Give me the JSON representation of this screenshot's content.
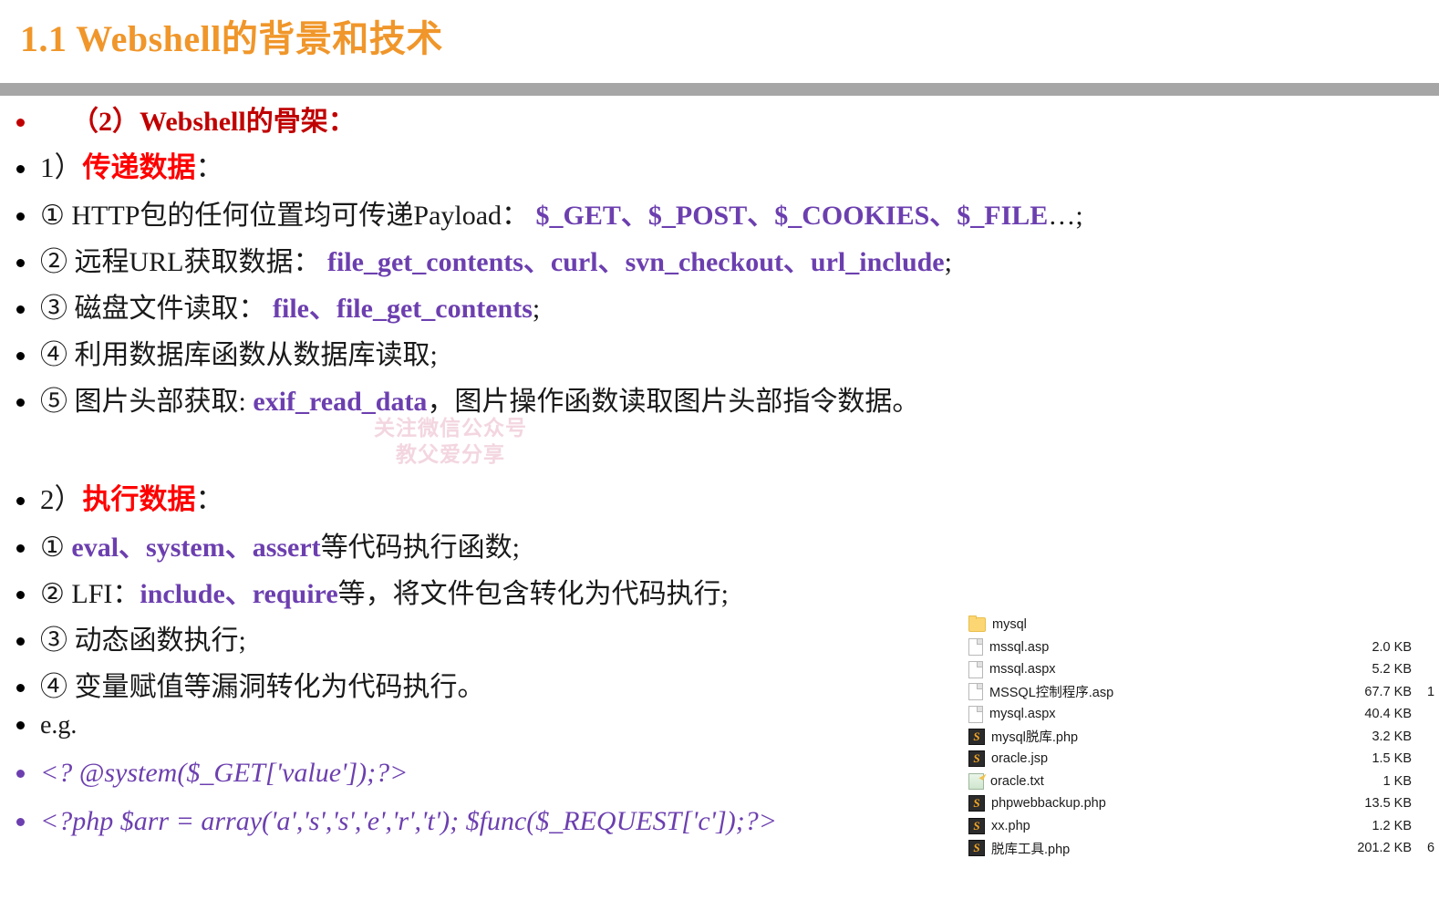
{
  "slide": {
    "title": "1.1 Webshell的背景和技术",
    "title_color": "#F0962A",
    "rule_color": "#A6A6A6",
    "background": "#FFFFFF"
  },
  "watermark": {
    "line1": "关注微信公众号",
    "line2": "教父爱分享",
    "color": "#F3D6E0"
  },
  "colors": {
    "code_purple": "#6C3FAF",
    "heading_red": "#C00000",
    "bright_red": "#FF0000",
    "body_black": "#1A1A1A"
  },
  "bullets": [
    {
      "id": "heading-skeleton",
      "dot_color": "#C00000",
      "runs": [
        {
          "text": "（2）Webshell的骨架：",
          "style": "red-serif-bold"
        }
      ]
    },
    {
      "id": "section-1-pass-data",
      "dot_color": "#000000",
      "runs": [
        {
          "text": "1）",
          "style": "serif-black"
        },
        {
          "text": "传递数据",
          "style": "bright-red-bold"
        },
        {
          "text": "：",
          "style": "serif-black"
        }
      ]
    },
    {
      "id": "item-1-1",
      "dot_color": "#000000",
      "runs": [
        {
          "text": "① HTTP包的任何位置均可传递Payload：",
          "style": "serif-black"
        },
        {
          "text": "  $_GET、$_POST、$_COOKIES、$_FILE",
          "style": "code-purple"
        },
        {
          "text": "…;",
          "style": "serif-black"
        }
      ]
    },
    {
      "id": "item-1-2",
      "dot_color": "#000000",
      "runs": [
        {
          "text": "② 远程URL获取数据：",
          "style": "serif-black"
        },
        {
          "text": "  file_get_contents、curl、svn_checkout、url_include",
          "style": "code-purple"
        },
        {
          "text": ";",
          "style": "serif-black"
        }
      ]
    },
    {
      "id": "item-1-3",
      "dot_color": "#000000",
      "runs": [
        {
          "text": "③ 磁盘文件读取：",
          "style": "serif-black"
        },
        {
          "text": "  file、file_get_contents",
          "style": "code-purple"
        },
        {
          "text": ";",
          "style": "serif-black"
        }
      ]
    },
    {
      "id": "item-1-4",
      "dot_color": "#000000",
      "runs": [
        {
          "text": "④ 利用数据库函数从数据库读取;",
          "style": "serif-black"
        }
      ]
    },
    {
      "id": "item-1-5",
      "dot_color": "#000000",
      "runs": [
        {
          "text": "⑤ 图片头部获取: ",
          "style": "serif-black"
        },
        {
          "text": "exif_read_data",
          "style": "code-purple"
        },
        {
          "text": "，图片操作函数读取图片头部指令数据。",
          "style": "serif-black"
        }
      ]
    },
    {
      "id": "section-2-exec-data",
      "dot_color": "#000000",
      "runs": [
        {
          "text": "2）",
          "style": "serif-black"
        },
        {
          "text": "执行数据",
          "style": "bright-red-bold"
        },
        {
          "text": "：",
          "style": "serif-black"
        }
      ]
    },
    {
      "id": "item-2-1",
      "dot_color": "#000000",
      "runs": [
        {
          "text": "① ",
          "style": "serif-black"
        },
        {
          "text": "eval、system、assert",
          "style": "code-purple"
        },
        {
          "text": "等代码执行函数;",
          "style": "serif-black"
        }
      ]
    },
    {
      "id": "item-2-2",
      "dot_color": "#000000",
      "runs": [
        {
          "text": "② LFI：",
          "style": "serif-black"
        },
        {
          "text": "include、require",
          "style": "code-purple"
        },
        {
          "text": "等，将文件包含转化为代码执行;",
          "style": "serif-black"
        }
      ]
    },
    {
      "id": "item-2-3",
      "dot_color": "#000000",
      "runs": [
        {
          "text": "③ 动态函数执行;",
          "style": "serif-black"
        }
      ]
    },
    {
      "id": "item-2-4",
      "dot_color": "#000000",
      "runs": [
        {
          "text": "④ 变量赋值等漏洞转化为代码执行。",
          "style": "serif-black"
        }
      ]
    },
    {
      "id": "example-label",
      "dot_color": "#000000",
      "runs": [
        {
          "text": "e.g.",
          "style": "serif-black"
        }
      ]
    },
    {
      "id": "code-example-1",
      "dot_color": "#6C3FAF",
      "runs": [
        {
          "text": "<? @system($_GET['value']);?>",
          "style": "italic-purple"
        }
      ]
    },
    {
      "id": "code-example-2",
      "dot_color": "#6C3FAF",
      "runs": [
        {
          "text": "<?php $arr = array('a','s','s','e','r','t'); $func($_REQUEST['c']);?>",
          "style": "italic-purple"
        }
      ]
    }
  ],
  "file_explorer": {
    "rows": [
      {
        "name": "mysql",
        "size": "",
        "icon": "folder-icon",
        "edge": ""
      },
      {
        "name": "mssql.asp",
        "size": "2.0 KB",
        "icon": "document-icon",
        "edge": ""
      },
      {
        "name": "mssql.aspx",
        "size": "5.2 KB",
        "icon": "document-icon",
        "edge": ""
      },
      {
        "name": "MSSQL控制程序.asp",
        "size": "67.7 KB",
        "icon": "document-icon",
        "edge": "1"
      },
      {
        "name": "mysql.aspx",
        "size": "40.4 KB",
        "icon": "document-icon",
        "edge": ""
      },
      {
        "name": "mysql脱库.php",
        "size": "3.2 KB",
        "icon": "php-icon",
        "edge": ""
      },
      {
        "name": "oracle.jsp",
        "size": "1.5 KB",
        "icon": "php-icon",
        "edge": ""
      },
      {
        "name": "oracle.txt",
        "size": "1 KB",
        "icon": "text-icon",
        "edge": ""
      },
      {
        "name": "phpwebbackup.php",
        "size": "13.5 KB",
        "icon": "php-icon",
        "edge": ""
      },
      {
        "name": "xx.php",
        "size": "1.2 KB",
        "icon": "php-icon",
        "edge": ""
      },
      {
        "name": "脱库工具.php",
        "size": "201.2 KB",
        "icon": "php-icon",
        "edge": "6"
      }
    ]
  }
}
